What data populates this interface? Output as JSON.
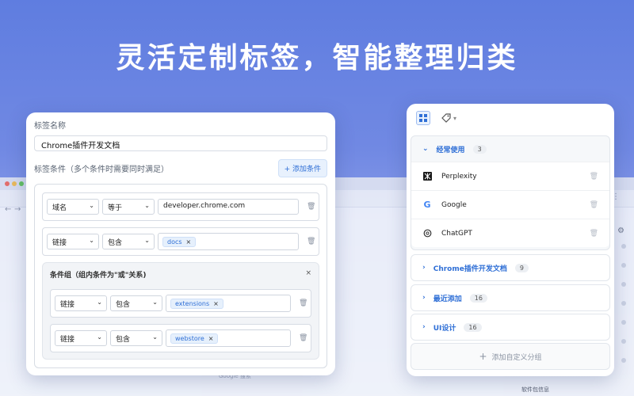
{
  "headline": "灵活定制标签，智能整理归类",
  "background": {
    "footer_hint": "Google 搜索",
    "right_bottom_text": "软件包信息"
  },
  "editor": {
    "name_label": "标签名称",
    "name_value": "Chrome插件开发文档",
    "conditions_label": "标签条件（多个条件时需要同时满足）",
    "add_condition_button": "+ 添加条件",
    "rules": [
      {
        "field": "域名",
        "operator": "等于",
        "value": "developer.chrome.com"
      },
      {
        "field": "链接",
        "operator": "包含",
        "tag": "docs"
      }
    ],
    "group": {
      "title": "条件组（组内条件为\"或\"关系)",
      "close": "×",
      "rules": [
        {
          "field": "链接",
          "operator": "包含",
          "tag": "extensions"
        },
        {
          "field": "链接",
          "operator": "包含",
          "tag": "webstore"
        }
      ]
    },
    "tag_remove": "×"
  },
  "groups_panel": {
    "expanded_group": {
      "name": "经常使用",
      "count": "3",
      "sites": [
        {
          "name": "Perplexity",
          "icon": "perplexity-icon"
        },
        {
          "name": "Google",
          "icon": "google-icon"
        },
        {
          "name": "ChatGPT",
          "icon": "chatgpt-icon"
        }
      ]
    },
    "collapsed_groups": [
      {
        "name": "Chrome插件开发文档",
        "count": "9"
      },
      {
        "name": "最近添加",
        "count": "16"
      },
      {
        "name": "UI设计",
        "count": "16"
      }
    ],
    "add_group_label": "添加自定义分组",
    "add_group_icon": "+"
  },
  "colors": {
    "accent": "#2f6fd6",
    "background_top": "#5f7de0",
    "background_bottom": "#bcc8f1"
  }
}
